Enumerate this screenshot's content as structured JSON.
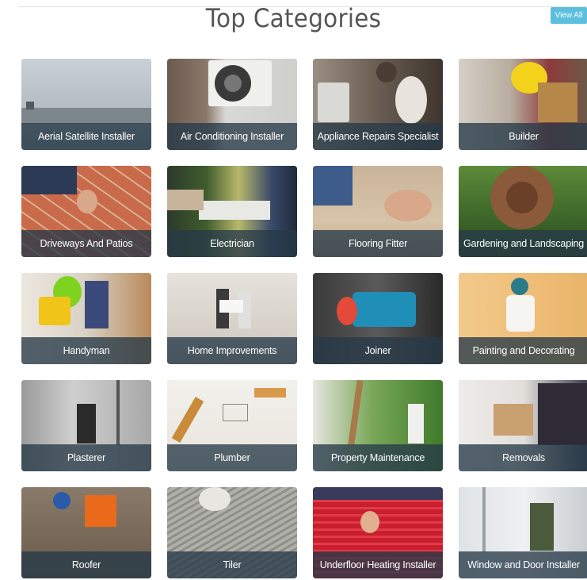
{
  "header": {
    "title": "Top Categories",
    "view_all_label": "View All",
    "view_all_color": "#5bc0de"
  },
  "categories": [
    {
      "label": "Aerial Satellite Installer"
    },
    {
      "label": "Air Conditioning Installer"
    },
    {
      "label": "Appliance Repairs Specialist"
    },
    {
      "label": "Builder"
    },
    {
      "label": "Driveways And Patios"
    },
    {
      "label": "Electrician"
    },
    {
      "label": "Flooring Fitter"
    },
    {
      "label": "Gardening and Landscaping"
    },
    {
      "label": "Handyman"
    },
    {
      "label": "Home Improvements"
    },
    {
      "label": "Joiner"
    },
    {
      "label": "Painting and Decorating"
    },
    {
      "label": "Plasterer"
    },
    {
      "label": "Plumber"
    },
    {
      "label": "Property Maintenance"
    },
    {
      "label": "Removals"
    },
    {
      "label": "Roofer"
    },
    {
      "label": "Tiler"
    },
    {
      "label": "Underfloor Heating Installer"
    },
    {
      "label": "Window and Door Installer"
    }
  ]
}
